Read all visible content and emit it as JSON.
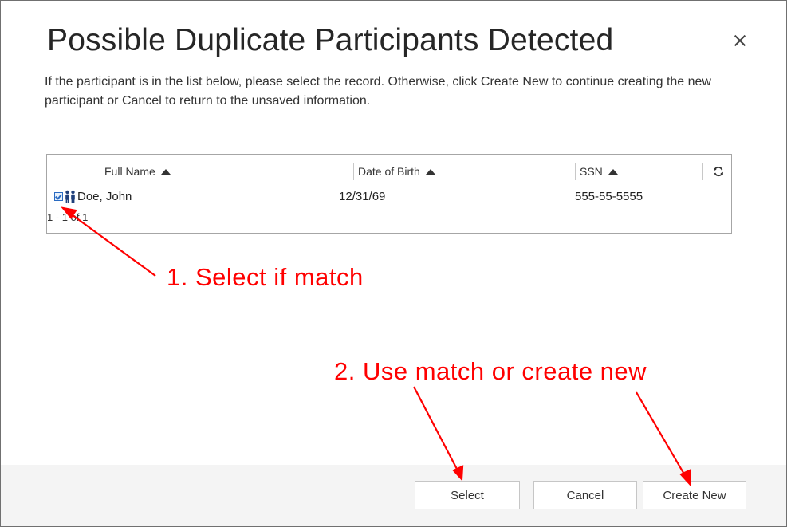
{
  "dialog": {
    "title": "Possible Duplicate Participants Detected",
    "description": "If the participant is in the list below, please select the record. Otherwise, click Create New to continue creating the new participant or Cancel to return to the unsaved information."
  },
  "grid": {
    "columns": [
      {
        "label": "Full Name",
        "sort": "ascending"
      },
      {
        "label": "Date of Birth",
        "sort": "ascending"
      },
      {
        "label": "SSN",
        "sort": "ascending"
      }
    ],
    "rows": [
      {
        "full_name": "Doe, John",
        "date_of_birth": "12/31/69",
        "ssn": "555-55-5555",
        "selected": true
      }
    ],
    "pager": "1 - 1 of 1",
    "refresh_icon": "refresh-icon"
  },
  "annotations": {
    "step1": "1. Select if match",
    "step2": "2. Use match  or  create new",
    "color": "#ff0000"
  },
  "buttons": {
    "select": "Select",
    "cancel": "Cancel",
    "create_new": "Create New"
  },
  "colors": {
    "checkbox_accent": "#2a6bc2",
    "people_icon": "#1f3f7a",
    "footer_bg": "#f4f4f4"
  }
}
